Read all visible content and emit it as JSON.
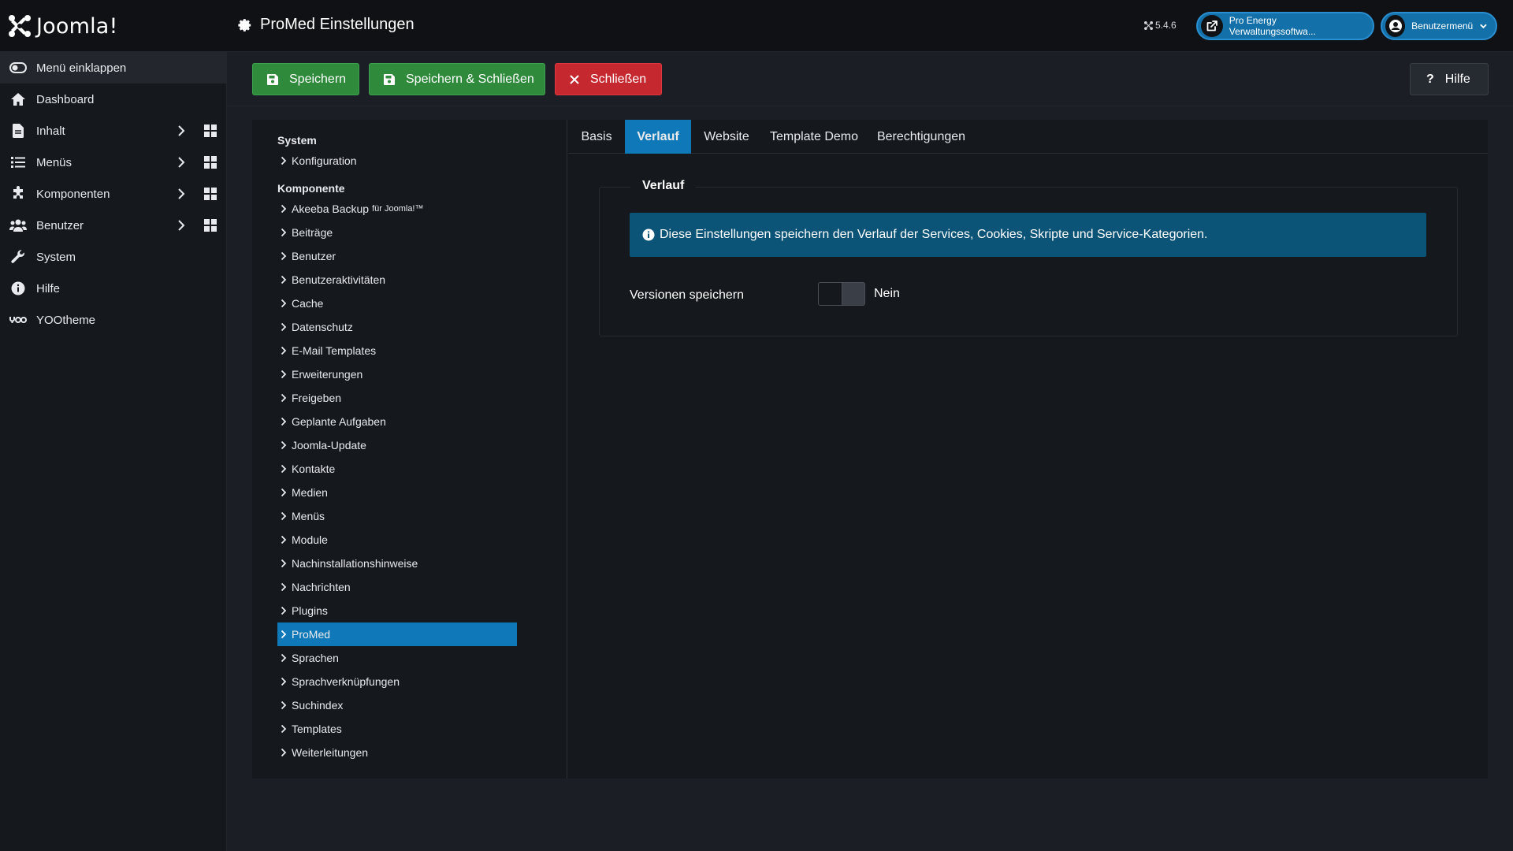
{
  "header": {
    "logo_text": "Joomla!",
    "page_title": "ProMed Einstellungen",
    "version": "5.4.6",
    "site_button": "Pro Energy Verwaltungssoftwa...",
    "user_menu": "Benutzermenü"
  },
  "sidebar": {
    "items": [
      {
        "label": "Menü einklappen",
        "icon": "eye-toggle-icon"
      },
      {
        "label": "Dashboard",
        "icon": "home-icon"
      },
      {
        "label": "Inhalt",
        "icon": "file-icon"
      },
      {
        "label": "Menüs",
        "icon": "list-icon"
      },
      {
        "label": "Komponenten",
        "icon": "puzzle-icon"
      },
      {
        "label": "Benutzer",
        "icon": "users-icon"
      },
      {
        "label": "System",
        "icon": "wrench-icon"
      },
      {
        "label": "Hilfe",
        "icon": "info-icon"
      },
      {
        "label": "YOOtheme",
        "icon": "yootheme-icon"
      }
    ]
  },
  "toolbar": {
    "save": "Speichern",
    "save_close": "Speichern & Schließen",
    "close": "Schließen",
    "help": "Hilfe"
  },
  "tree": {
    "system_heading": "System",
    "system_items": [
      "Konfiguration"
    ],
    "component_heading": "Komponente",
    "akeeba_main": "Akeeba Backup",
    "akeeba_small": "für Joomla!™",
    "component_items": [
      "Beiträge",
      "Benutzer",
      "Benutzeraktivitäten",
      "Cache",
      "Datenschutz",
      "E-Mail Templates",
      "Erweiterungen",
      "Freigeben",
      "Geplante Aufgaben",
      "Joomla-Update",
      "Kontakte",
      "Medien",
      "Menüs",
      "Module",
      "Nachinstallationshinweise",
      "Nachrichten",
      "Plugins",
      "ProMed",
      "Sprachen",
      "Sprachverknüpfungen",
      "Suchindex",
      "Templates",
      "Weiterleitungen"
    ],
    "selected": "ProMed"
  },
  "tabs": {
    "items": [
      "Basis",
      "Verlauf",
      "Website",
      "Template Demo",
      "Berechtigungen"
    ],
    "active": "Verlauf"
  },
  "panel": {
    "legend": "Verlauf",
    "alert": "Diese Einstellungen speichern den Verlauf der Services, Cookies, Skripte und Service-Kategorien.",
    "field_label": "Versionen speichern",
    "toggle_value": "Nein"
  },
  "colors": {
    "accent": "#0f78b8",
    "success": "#2f8a3c",
    "danger": "#c5282e",
    "alert_bg": "#0b5377"
  }
}
